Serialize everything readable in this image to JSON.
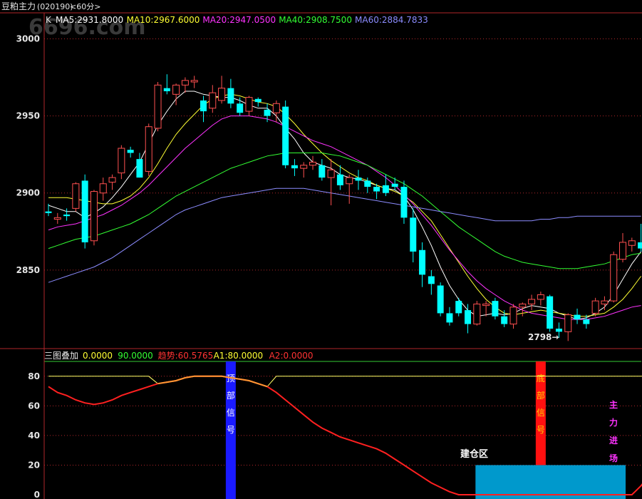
{
  "window": {
    "title": "豆粕主力",
    "code": "(020190)",
    "period": "<60分>"
  },
  "watermark": "6696.com",
  "price_header": {
    "k_label": "K",
    "items": [
      {
        "text": "MA5:2931.8000",
        "color": "#ffffff"
      },
      {
        "text": "MA10:2967.6000",
        "color": "#ffff33"
      },
      {
        "text": "MA20:2947.0500",
        "color": "#ff33ff"
      },
      {
        "text": "MA40:2908.7500",
        "color": "#33ff33"
      },
      {
        "text": "MA60:2884.7833",
        "color": "#8c8cff"
      }
    ]
  },
  "indicator_header": {
    "name": "三图叠加",
    "items": [
      {
        "text": "0.0000",
        "color": "#ffff33"
      },
      {
        "text": "90.0000",
        "color": "#33ff33"
      },
      {
        "text": "趋势:60.5765",
        "color": "#ff3333"
      },
      {
        "text": "A1:80.0000",
        "color": "#ffff33"
      },
      {
        "text": "A2:0.0000",
        "color": "#ff3333"
      }
    ]
  },
  "annotations": {
    "low_marker": "2798→",
    "top_signal": [
      "顶",
      "部",
      "信",
      "号"
    ],
    "bottom_signal": [
      "底",
      "部",
      "信",
      "号"
    ],
    "build_zone": "建仓区",
    "main_entry": [
      "主",
      "力",
      "进",
      "场"
    ]
  },
  "colors": {
    "frame": "#b0262a",
    "up": "#ff5050",
    "down": "#00ffff",
    "trend": "#ff2020",
    "a1": "#ffff66",
    "top_bar": "#1a1aff",
    "bottom_bar": "#ff1010",
    "build_box": "#0099cc",
    "magenta_text": "#ff33ff",
    "axis_text": "#e6e6e6"
  },
  "chart_data": [
    {
      "type": "candlestick",
      "ylim": [
        2800,
        3015
      ],
      "y_ticks": [
        2850,
        2900,
        2950,
        3000
      ],
      "low_label_value": 2798,
      "candles": [
        [
          2888,
          2893,
          2885,
          2887
        ],
        [
          2883,
          2887,
          2880,
          2884
        ],
        [
          2886,
          2890,
          2882,
          2885
        ],
        [
          2890,
          2907,
          2888,
          2906
        ],
        [
          2908,
          2912,
          2864,
          2868
        ],
        [
          2869,
          2902,
          2866,
          2901
        ],
        [
          2900,
          2910,
          2895,
          2906
        ],
        [
          2907,
          2912,
          2902,
          2910
        ],
        [
          2913,
          2931,
          2909,
          2929
        ],
        [
          2928,
          2930,
          2923,
          2926
        ],
        [
          2922,
          2926,
          2910,
          2910
        ],
        [
          2914,
          2945,
          2911,
          2943
        ],
        [
          2942,
          2972,
          2940,
          2970
        ],
        [
          2968,
          2977,
          2964,
          2966
        ],
        [
          2964,
          2971,
          2957,
          2970
        ],
        [
          2970,
          2975,
          2965,
          2973
        ],
        [
          2972,
          2976,
          2968,
          2973
        ],
        [
          2960,
          2963,
          2946,
          2953
        ],
        [
          2955,
          2970,
          2952,
          2965
        ],
        [
          2960,
          2976,
          2958,
          2968
        ],
        [
          2968,
          2974,
          2955,
          2958
        ],
        [
          2958,
          2962,
          2950,
          2952
        ],
        [
          2953,
          2963,
          2950,
          2962
        ],
        [
          2961,
          2962,
          2956,
          2959
        ],
        [
          2954,
          2958,
          2946,
          2950
        ],
        [
          2952,
          2960,
          2946,
          2958
        ],
        [
          2956,
          2960,
          2916,
          2918
        ],
        [
          2918,
          2922,
          2911,
          2916
        ],
        [
          2916,
          2920,
          2910,
          2918
        ],
        [
          2918,
          2924,
          2915,
          2920
        ],
        [
          2918,
          2922,
          2908,
          2910
        ],
        [
          2910,
          2922,
          2892,
          2915
        ],
        [
          2912,
          2918,
          2902,
          2905
        ],
        [
          2906,
          2912,
          2893,
          2910
        ],
        [
          2910,
          2915,
          2902,
          2908
        ],
        [
          2908,
          2910,
          2900,
          2904
        ],
        [
          2904,
          2906,
          2896,
          2901
        ],
        [
          2905,
          2912,
          2898,
          2900
        ],
        [
          2906,
          2910,
          2902,
          2904
        ],
        [
          2904,
          2908,
          2880,
          2884
        ],
        [
          2884,
          2890,
          2855,
          2862
        ],
        [
          2863,
          2868,
          2839,
          2847
        ],
        [
          2846,
          2850,
          2834,
          2841
        ],
        [
          2840,
          2842,
          2820,
          2822
        ],
        [
          2822,
          2826,
          2814,
          2816
        ],
        [
          2830,
          2832,
          2820,
          2822
        ],
        [
          2824,
          2828,
          2809,
          2815
        ],
        [
          2815,
          2830,
          2814,
          2828
        ],
        [
          2827,
          2830,
          2820,
          2828
        ],
        [
          2830,
          2832,
          2818,
          2820
        ],
        [
          2820,
          2824,
          2813,
          2815
        ],
        [
          2815,
          2828,
          2812,
          2826
        ],
        [
          2826,
          2829,
          2820,
          2828
        ],
        [
          2828,
          2834,
          2824,
          2831
        ],
        [
          2831,
          2836,
          2827,
          2834
        ],
        [
          2833,
          2834,
          2810,
          2812
        ],
        [
          2812,
          2816,
          2806,
          2810
        ],
        [
          2810,
          2822,
          2804,
          2821
        ],
        [
          2821,
          2825,
          2815,
          2818
        ],
        [
          2818,
          2821,
          2812,
          2815
        ],
        [
          2822,
          2832,
          2820,
          2830
        ],
        [
          2828,
          2833,
          2824,
          2830
        ],
        [
          2830,
          2862,
          2829,
          2860
        ],
        [
          2857,
          2874,
          2855,
          2868
        ],
        [
          2866,
          2871,
          2862,
          2869
        ],
        [
          2868,
          2880,
          2862,
          2864
        ]
      ],
      "ma_lines": [
        {
          "name": "MA5",
          "color": "#ffffff",
          "values": [
            2892,
            2890,
            2888,
            2888,
            2884,
            2887,
            2891,
            2897,
            2904,
            2912,
            2920,
            2932,
            2944,
            2953,
            2961,
            2966,
            2966,
            2964,
            2963,
            2962,
            2962,
            2960,
            2957,
            2955,
            2955,
            2950,
            2942,
            2935,
            2926,
            2920,
            2918,
            2916,
            2912,
            2910,
            2909,
            2907,
            2905,
            2903,
            2902,
            2898,
            2889,
            2878,
            2866,
            2852,
            2840,
            2831,
            2824,
            2820,
            2821,
            2822,
            2821,
            2822,
            2825,
            2827,
            2826,
            2825,
            2822,
            2820,
            2818,
            2819,
            2822,
            2826,
            2834,
            2844,
            2854,
            2862
          ]
        },
        {
          "name": "MA10",
          "color": "#ffff33",
          "values": [
            2897,
            2897,
            2897,
            2896,
            2895,
            2894,
            2893,
            2893,
            2895,
            2898,
            2903,
            2910,
            2919,
            2929,
            2938,
            2945,
            2951,
            2957,
            2961,
            2963,
            2964,
            2963,
            2961,
            2959,
            2958,
            2956,
            2951,
            2945,
            2938,
            2932,
            2926,
            2921,
            2917,
            2913,
            2910,
            2908,
            2905,
            2903,
            2901,
            2898,
            2894,
            2888,
            2882,
            2873,
            2864,
            2855,
            2846,
            2838,
            2831,
            2826,
            2822,
            2821,
            2822,
            2823,
            2824,
            2823,
            2822,
            2821,
            2820,
            2820,
            2821,
            2822,
            2826,
            2831,
            2838,
            2846
          ]
        },
        {
          "name": "MA20",
          "color": "#ff33ff",
          "values": [
            2876,
            2878,
            2879,
            2880,
            2882,
            2884,
            2886,
            2889,
            2892,
            2896,
            2900,
            2905,
            2911,
            2917,
            2923,
            2929,
            2934,
            2939,
            2944,
            2948,
            2950,
            2950,
            2950,
            2949,
            2948,
            2946,
            2943,
            2940,
            2937,
            2934,
            2932,
            2930,
            2927,
            2924,
            2921,
            2918,
            2914,
            2910,
            2905,
            2899,
            2893,
            2886,
            2879,
            2871,
            2863,
            2856,
            2849,
            2843,
            2838,
            2834,
            2830,
            2827,
            2824,
            2822,
            2821,
            2820,
            2819,
            2818,
            2818,
            2818,
            2819,
            2820,
            2822,
            2824,
            2826,
            2827
          ]
        },
        {
          "name": "MA40",
          "color": "#33ff33",
          "values": [
            2864,
            2866,
            2868,
            2870,
            2871,
            2872,
            2874,
            2876,
            2878,
            2880,
            2883,
            2886,
            2890,
            2894,
            2898,
            2901,
            2904,
            2907,
            2910,
            2913,
            2916,
            2918,
            2920,
            2922,
            2924,
            2925,
            2926,
            2926,
            2926,
            2926,
            2926,
            2925,
            2924,
            2922,
            2920,
            2918,
            2915,
            2912,
            2909,
            2906,
            2902,
            2898,
            2893,
            2888,
            2883,
            2878,
            2874,
            2870,
            2866,
            2862,
            2859,
            2857,
            2855,
            2854,
            2853,
            2852,
            2851,
            2851,
            2851,
            2852,
            2853,
            2854,
            2856,
            2858,
            2860,
            2861
          ]
        },
        {
          "name": "MA60",
          "color": "#8c8cff",
          "values": [
            2842,
            2844,
            2846,
            2848,
            2850,
            2852,
            2855,
            2858,
            2862,
            2866,
            2870,
            2874,
            2878,
            2882,
            2886,
            2889,
            2891,
            2893,
            2895,
            2897,
            2898,
            2899,
            2900,
            2901,
            2902,
            2903,
            2903,
            2903,
            2903,
            2902,
            2901,
            2900,
            2899,
            2898,
            2897,
            2896,
            2895,
            2894,
            2893,
            2892,
            2891,
            2890,
            2889,
            2888,
            2887,
            2886,
            2885,
            2884,
            2883,
            2882,
            2882,
            2882,
            2882,
            2882,
            2883,
            2883,
            2884,
            2884,
            2885,
            2885,
            2885,
            2885,
            2885,
            2885,
            2885,
            2885
          ]
        }
      ]
    },
    {
      "type": "line",
      "ylim": [
        0,
        90
      ],
      "y_ticks": [
        0,
        20,
        40,
        60,
        80
      ],
      "series": [
        {
          "name": "趋势",
          "color": "#ff2020",
          "values": [
            73,
            69,
            67,
            64,
            62,
            61,
            62,
            64,
            67,
            69,
            71,
            73,
            75,
            76,
            77,
            79,
            80,
            80,
            80,
            80,
            79,
            78,
            77,
            75,
            73,
            69,
            64,
            59,
            54,
            49,
            45,
            42,
            39,
            37,
            35,
            33,
            31,
            28,
            24,
            20,
            16,
            12,
            8,
            5,
            2,
            0,
            0,
            0,
            0,
            0,
            0,
            0,
            0,
            0,
            0,
            0,
            0,
            0,
            0,
            0,
            0,
            0,
            0,
            0,
            0,
            6,
            14
          ]
        },
        {
          "name": "A1",
          "color": "#ffff66",
          "values": [
            80,
            80,
            80,
            80,
            80,
            80,
            80,
            80,
            80,
            80,
            80,
            80,
            80,
            80,
            80,
            80,
            80,
            80,
            80,
            80,
            80,
            80,
            80,
            80,
            80,
            80,
            80,
            80,
            80,
            80,
            80,
            80,
            80,
            80,
            80,
            80,
            80,
            80,
            80,
            80,
            80,
            80,
            80,
            80,
            80,
            80,
            80,
            80,
            80,
            80,
            80,
            80,
            80,
            80,
            80,
            80,
            80,
            80,
            80,
            80,
            80,
            80,
            80,
            80,
            80,
            80,
            80
          ]
        }
      ]
    }
  ]
}
